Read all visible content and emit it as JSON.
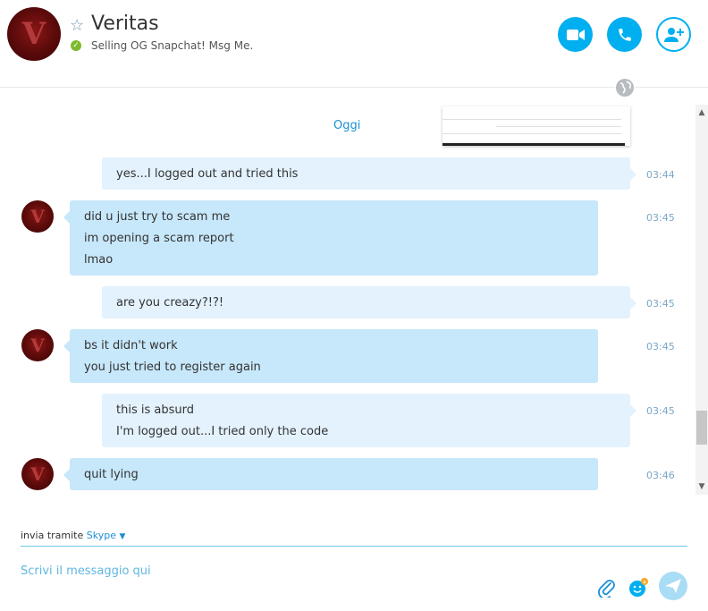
{
  "contact": {
    "name": "Veritas",
    "avatar_letter": "V",
    "mood": "Selling OG Snapchat! Msg Me.",
    "status": "online"
  },
  "header_buttons": {
    "video_call": "video-call",
    "voice_call": "voice-call",
    "add_people": "add-people"
  },
  "chat": {
    "date_separator": "Oggi",
    "messages": [
      {
        "direction": "out",
        "lines": [
          "yes...I logged out and tried this"
        ],
        "time": "03:44"
      },
      {
        "direction": "in",
        "lines": [
          "did u just try to scam me",
          "im opening a scam report",
          "lmao"
        ],
        "time": "03:45"
      },
      {
        "direction": "out",
        "lines": [
          "are you creazy?!?!"
        ],
        "time": "03:45"
      },
      {
        "direction": "in",
        "lines": [
          "bs it didn't work",
          "you just tried to register again"
        ],
        "time": "03:45"
      },
      {
        "direction": "out",
        "lines": [
          "this is absurd",
          "I'm logged out...I tried only the code"
        ],
        "time": "03:45"
      },
      {
        "direction": "in",
        "lines": [
          "quit lying"
        ],
        "time": "03:46"
      }
    ]
  },
  "compose": {
    "via_label": "invia tramite",
    "via_service": "Skype",
    "placeholder": "Scrivi il messaggio qui"
  },
  "colors": {
    "accent": "#00aff0",
    "link": "#1a8fd3",
    "bubble_out": "#e3f2fd",
    "bubble_in": "#c7e7fa",
    "status_online": "#7cbb2d"
  }
}
